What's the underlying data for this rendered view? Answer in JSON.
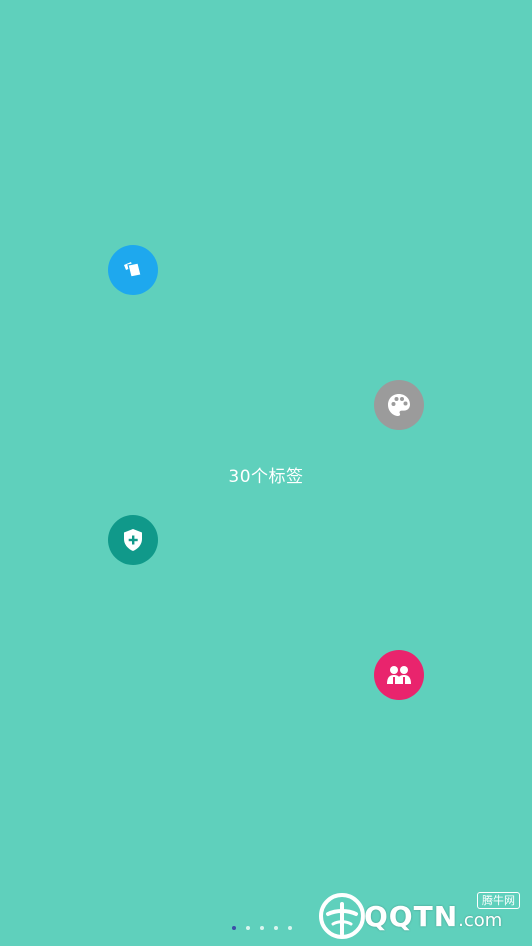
{
  "page": {
    "background_color": "#5fd0bc",
    "label": "30个标签"
  },
  "floating_icons": [
    {
      "name": "cards-icon",
      "color": "#1ea8ee"
    },
    {
      "name": "palette-icon",
      "color": "#9b9b9b"
    },
    {
      "name": "shield-plus-icon",
      "color": "#10998a"
    },
    {
      "name": "people-icon",
      "color": "#e9246d"
    }
  ],
  "pager": {
    "count": 5,
    "active_index": 0,
    "active_color": "#3b4ea8"
  },
  "watermark": {
    "brand": "QQTN",
    "suffix": ".com",
    "tag": "腾牛网"
  }
}
